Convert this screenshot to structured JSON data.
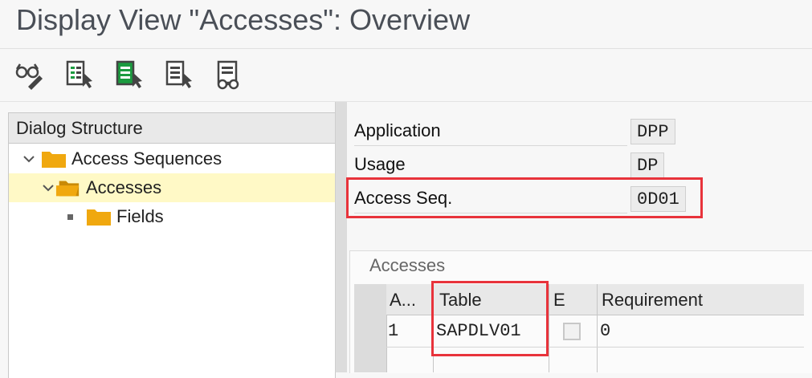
{
  "window": {
    "title": "Display View \"Accesses\": Overview"
  },
  "toolbar": {
    "buttons": [
      {
        "icon": "glasses-pencil-icon"
      },
      {
        "icon": "select-all-icon"
      },
      {
        "icon": "select-block-icon"
      },
      {
        "icon": "deselect-all-icon"
      },
      {
        "icon": "details-glasses-icon"
      }
    ]
  },
  "dialog_structure": {
    "header": "Dialog Structure",
    "items": [
      {
        "label": "Access Sequences",
        "level": 0,
        "expanded": true,
        "selected": false,
        "icon": "folder-icon"
      },
      {
        "label": "Accesses",
        "level": 1,
        "expanded": true,
        "selected": true,
        "icon": "folder-open-icon"
      },
      {
        "label": "Fields",
        "level": 2,
        "expanded": false,
        "selected": false,
        "icon": "folder-icon"
      }
    ]
  },
  "fields": {
    "application": {
      "label": "Application",
      "value": "DPP"
    },
    "usage": {
      "label": "Usage",
      "value": "DP"
    },
    "access_seq": {
      "label": "Access Seq.",
      "value": "0D01"
    }
  },
  "accesses": {
    "title": "Accesses",
    "columns": [
      "A...",
      "Table",
      "E",
      "Requirement"
    ],
    "rows": [
      {
        "access": "1",
        "table": "SAPDLV01",
        "exclusive": false,
        "requirement": "0"
      }
    ]
  },
  "colors": {
    "highlight": "#e8333b",
    "selected_row": "#fff9c6",
    "folder": "#f0a80f"
  }
}
